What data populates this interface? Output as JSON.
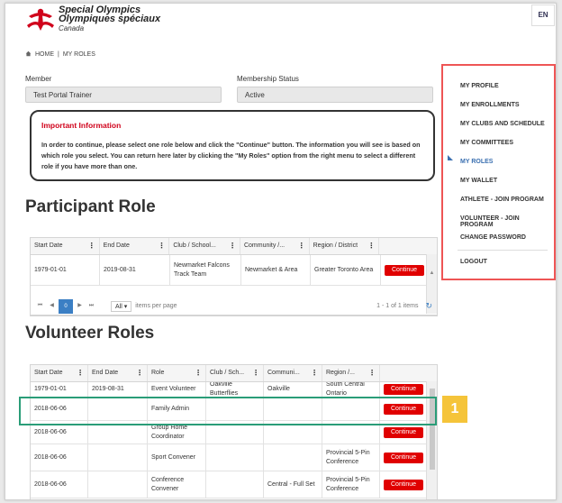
{
  "header": {
    "logo_line1": "Special Olympics",
    "logo_line2": "Olympiques spéciaux",
    "logo_line3": "Canada",
    "lang": "EN"
  },
  "breadcrumb": {
    "home": "HOME",
    "current": "MY ROLES"
  },
  "member": {
    "label": "Member",
    "value": "Test Portal Trainer"
  },
  "status": {
    "label": "Membership Status",
    "value": "Active"
  },
  "info": {
    "title": "Important Information",
    "text": "In order to continue, please select one role below and click the \"Continue\" button. The information you will see is based on which role you select. You can return here later by clicking the \"My Roles\" option from the right menu to select a different role if you have more than one."
  },
  "participant": {
    "title": "Participant Role",
    "headers": [
      "Start Date",
      "End Date",
      "Club / School...",
      "Community /...",
      "Region / District"
    ],
    "rows": [
      {
        "start": "1979-01-01",
        "end": "2019-08-31",
        "club": "Newmarket Falcons Track Team",
        "community": "Newmarket & Area",
        "region": "Greater Toronto Area",
        "action": "Continue"
      }
    ],
    "pager": {
      "page": "0",
      "select": "All",
      "per_page": "items per page",
      "summary": "1 - 1 of 1 items"
    }
  },
  "volunteer": {
    "title": "Volunteer Roles",
    "headers": [
      "Start Date",
      "End Date",
      "Role",
      "Club / Sch...",
      "Communi...",
      "Region /...",
      ""
    ],
    "rows": [
      {
        "start": "1979-01-01",
        "end": "2019-08-31",
        "role": "Event Volunteer",
        "club": "Oakville Butterflies",
        "community": "Oakville",
        "region": "South Central Ontario",
        "action": "Continue"
      },
      {
        "start": "2018-06-06",
        "end": "",
        "role": "Family Admin",
        "club": "",
        "community": "",
        "region": "",
        "action": "Continue"
      },
      {
        "start": "2018-06-06",
        "end": "",
        "role": "Group Home Coordinator",
        "club": "",
        "community": "",
        "region": "",
        "action": "Continue"
      },
      {
        "start": "2018-06-06",
        "end": "",
        "role": "Sport Convener",
        "club": "",
        "community": "",
        "region": "Provincial 5-Pin Conference",
        "action": "Continue"
      },
      {
        "start": "2018-06-06",
        "end": "",
        "role": "Conference Convener",
        "club": "",
        "community": "Central - Full Set",
        "region": "Provincial 5-Pin Conference",
        "action": "Continue"
      }
    ]
  },
  "menu": {
    "items": [
      "MY PROFILE",
      "MY ENROLLMENTS",
      "MY CLUBS AND SCHEDULE",
      "MY COMMITTEES",
      "MY ROLES",
      "MY WALLET",
      "ATHLETE - JOIN PROGRAM",
      "VOLUNTEER - JOIN PROGRAM",
      "CHANGE PASSWORD",
      "LOGOUT"
    ],
    "active": "MY ROLES"
  },
  "callout": {
    "number": "1"
  },
  "colors": {
    "accent": "#e00000",
    "menu_border": "#e55555",
    "highlight": "#2a9d78",
    "callout": "#f5c43a",
    "link": "#3a6fb0"
  }
}
